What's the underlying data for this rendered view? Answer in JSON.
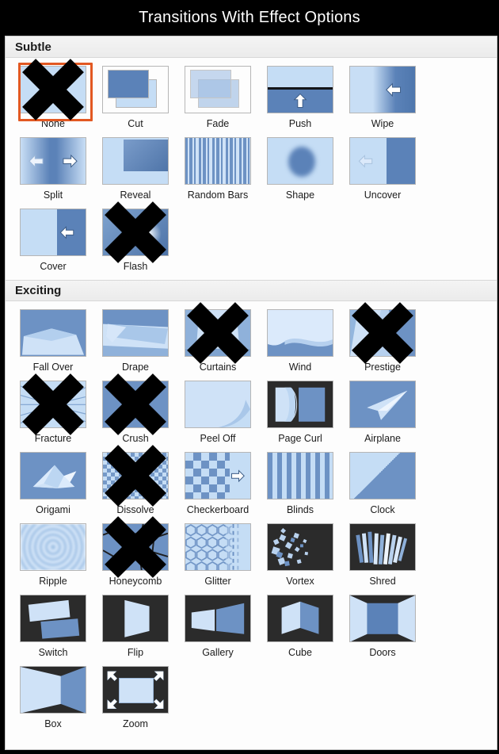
{
  "window": {
    "title": "Transitions With Effect Options",
    "title_color": "#ffffff",
    "background_color": "#000000",
    "panel_background": "#fdfdfd",
    "selection_color": "#e25822"
  },
  "sections": [
    {
      "name": "subtle",
      "header": "Subtle",
      "items": [
        {
          "label": "None",
          "art": "none",
          "selected": true,
          "crossed": true
        },
        {
          "label": "Cut",
          "art": "cut",
          "selected": false,
          "crossed": false
        },
        {
          "label": "Fade",
          "art": "fade",
          "selected": false,
          "crossed": false
        },
        {
          "label": "Push",
          "art": "push",
          "selected": false,
          "crossed": false
        },
        {
          "label": "Wipe",
          "art": "wipe",
          "selected": false,
          "crossed": false
        },
        {
          "label": "Split",
          "art": "split",
          "selected": false,
          "crossed": false
        },
        {
          "label": "Reveal",
          "art": "reveal",
          "selected": false,
          "crossed": false
        },
        {
          "label": "Random Bars",
          "art": "randombars",
          "selected": false,
          "crossed": false
        },
        {
          "label": "Shape",
          "art": "shape",
          "selected": false,
          "crossed": false
        },
        {
          "label": "Uncover",
          "art": "uncover",
          "selected": false,
          "crossed": false
        },
        {
          "label": "Cover",
          "art": "cover",
          "selected": false,
          "crossed": false
        },
        {
          "label": "Flash",
          "art": "flash",
          "selected": false,
          "crossed": true
        }
      ]
    },
    {
      "name": "exciting",
      "header": "Exciting",
      "items": [
        {
          "label": "Fall Over",
          "art": "fallover",
          "selected": false,
          "crossed": false
        },
        {
          "label": "Drape",
          "art": "drape",
          "selected": false,
          "crossed": false
        },
        {
          "label": "Curtains",
          "art": "curtains",
          "selected": false,
          "crossed": true
        },
        {
          "label": "Wind",
          "art": "wind",
          "selected": false,
          "crossed": false
        },
        {
          "label": "Prestige",
          "art": "prestige",
          "selected": false,
          "crossed": true
        },
        {
          "label": "Fracture",
          "art": "fracture",
          "selected": false,
          "crossed": true
        },
        {
          "label": "Crush",
          "art": "crush",
          "selected": false,
          "crossed": true
        },
        {
          "label": "Peel Off",
          "art": "peeloff",
          "selected": false,
          "crossed": false
        },
        {
          "label": "Page Curl",
          "art": "pagecurl",
          "selected": false,
          "crossed": false
        },
        {
          "label": "Airplane",
          "art": "airplane",
          "selected": false,
          "crossed": false
        },
        {
          "label": "Origami",
          "art": "origami",
          "selected": false,
          "crossed": false
        },
        {
          "label": "Dissolve",
          "art": "dissolve",
          "selected": false,
          "crossed": true
        },
        {
          "label": "Checkerboard",
          "art": "checkerboard",
          "selected": false,
          "crossed": false
        },
        {
          "label": "Blinds",
          "art": "blinds",
          "selected": false,
          "crossed": false
        },
        {
          "label": "Clock",
          "art": "clock",
          "selected": false,
          "crossed": false
        },
        {
          "label": "Ripple",
          "art": "ripple",
          "selected": false,
          "crossed": false
        },
        {
          "label": "Honeycomb",
          "art": "honeycomb",
          "selected": false,
          "crossed": true
        },
        {
          "label": "Glitter",
          "art": "glitter",
          "selected": false,
          "crossed": false
        },
        {
          "label": "Vortex",
          "art": "vortex",
          "selected": false,
          "crossed": false
        },
        {
          "label": "Shred",
          "art": "shred",
          "selected": false,
          "crossed": false
        },
        {
          "label": "Switch",
          "art": "switch",
          "selected": false,
          "crossed": false
        },
        {
          "label": "Flip",
          "art": "flip",
          "selected": false,
          "crossed": false
        },
        {
          "label": "Gallery",
          "art": "gallery",
          "selected": false,
          "crossed": false
        },
        {
          "label": "Cube",
          "art": "cube",
          "selected": false,
          "crossed": false
        },
        {
          "label": "Doors",
          "art": "doors",
          "selected": false,
          "crossed": false
        },
        {
          "label": "Box",
          "art": "box",
          "selected": false,
          "crossed": false
        },
        {
          "label": "Zoom",
          "art": "zoom",
          "selected": false,
          "crossed": false
        }
      ]
    }
  ]
}
